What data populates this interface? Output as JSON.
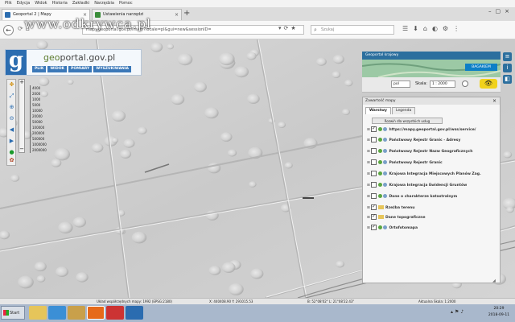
{
  "browser": {
    "menu": [
      "Plik",
      "Edycja",
      "Widok",
      "Historia",
      "Zakładki",
      "Narzędzia",
      "Pomoc"
    ],
    "tabs": [
      {
        "title": "Geoportal 2 | Mapy"
      },
      {
        "title": "Ustawienia narzędzi"
      }
    ],
    "new_tab": "+",
    "url": "mapy.geoportal.gov.pl/imap/?locale=pl&gui=new&sessionID=",
    "search_placeholder": "Szukaj",
    "watermark": "www.odkrywca.pl"
  },
  "geoportal": {
    "logo_letter": "g",
    "logo_geo": "geo",
    "logo_rest": "portal.gov.pl",
    "menu": [
      "PLIK",
      "WIDOK",
      "POMIARY",
      "WYSZUKIWANIA"
    ],
    "zoom_in": "+",
    "zoom_out": "−",
    "zoom_levels": [
      "4000",
      "2000",
      "1000",
      "5000",
      "10000",
      "20000",
      "50000",
      "100000",
      "200000",
      "500000",
      "1000000",
      "2000000"
    ],
    "overview_title": "Geoportal krajowy",
    "overview_badge": "BAGAKIEM",
    "scale_unit": "pol",
    "scale_label": "Skala:",
    "scale_value": "1 : 2000",
    "content_title": "Zawartość mapy",
    "content_close": "×",
    "content_tabs": [
      "Warstwy",
      "Legenda"
    ],
    "all_button": "Rozwiń dla wszystkich usług",
    "layers": [
      {
        "name": "https://mapy.geoportal.gov.pl/wss/service/",
        "checked": true,
        "folder": false
      },
      {
        "name": "Państwowy Rejestr Granic - Adresy",
        "checked": false,
        "folder": false
      },
      {
        "name": "Państwowy Rejestr Nazw Geograficznych",
        "checked": false,
        "folder": false
      },
      {
        "name": "Państwowy Rejestr Granic",
        "checked": false,
        "folder": false
      },
      {
        "name": "Krajowa Integracja Miejscowych Planów Zag.",
        "checked": false,
        "folder": false
      },
      {
        "name": "Krajowa Integracja Ewidencji Gruntów",
        "checked": false,
        "folder": false
      },
      {
        "name": "Dane o charakterze katastralnym",
        "checked": false,
        "folder": false
      },
      {
        "name": "Rzeźba terenu",
        "checked": true,
        "folder": true
      },
      {
        "name": "Dane topograficzne",
        "checked": true,
        "folder": true
      },
      {
        "name": "Ortofotomapa",
        "checked": true,
        "folder": false
      }
    ]
  },
  "status": {
    "system": "Układ współrzędnych mapy: 1992 (EPSG:2180)",
    "xy": "X: 440408.90 Y: 291015.53",
    "latlon": "B: 52°08'02\" L: 21°08'22.43\"",
    "scale": "Aktualna Skala: 1:2000"
  },
  "taskbar": {
    "start": "Start",
    "time": "20:29",
    "date": "2018-09-11"
  }
}
